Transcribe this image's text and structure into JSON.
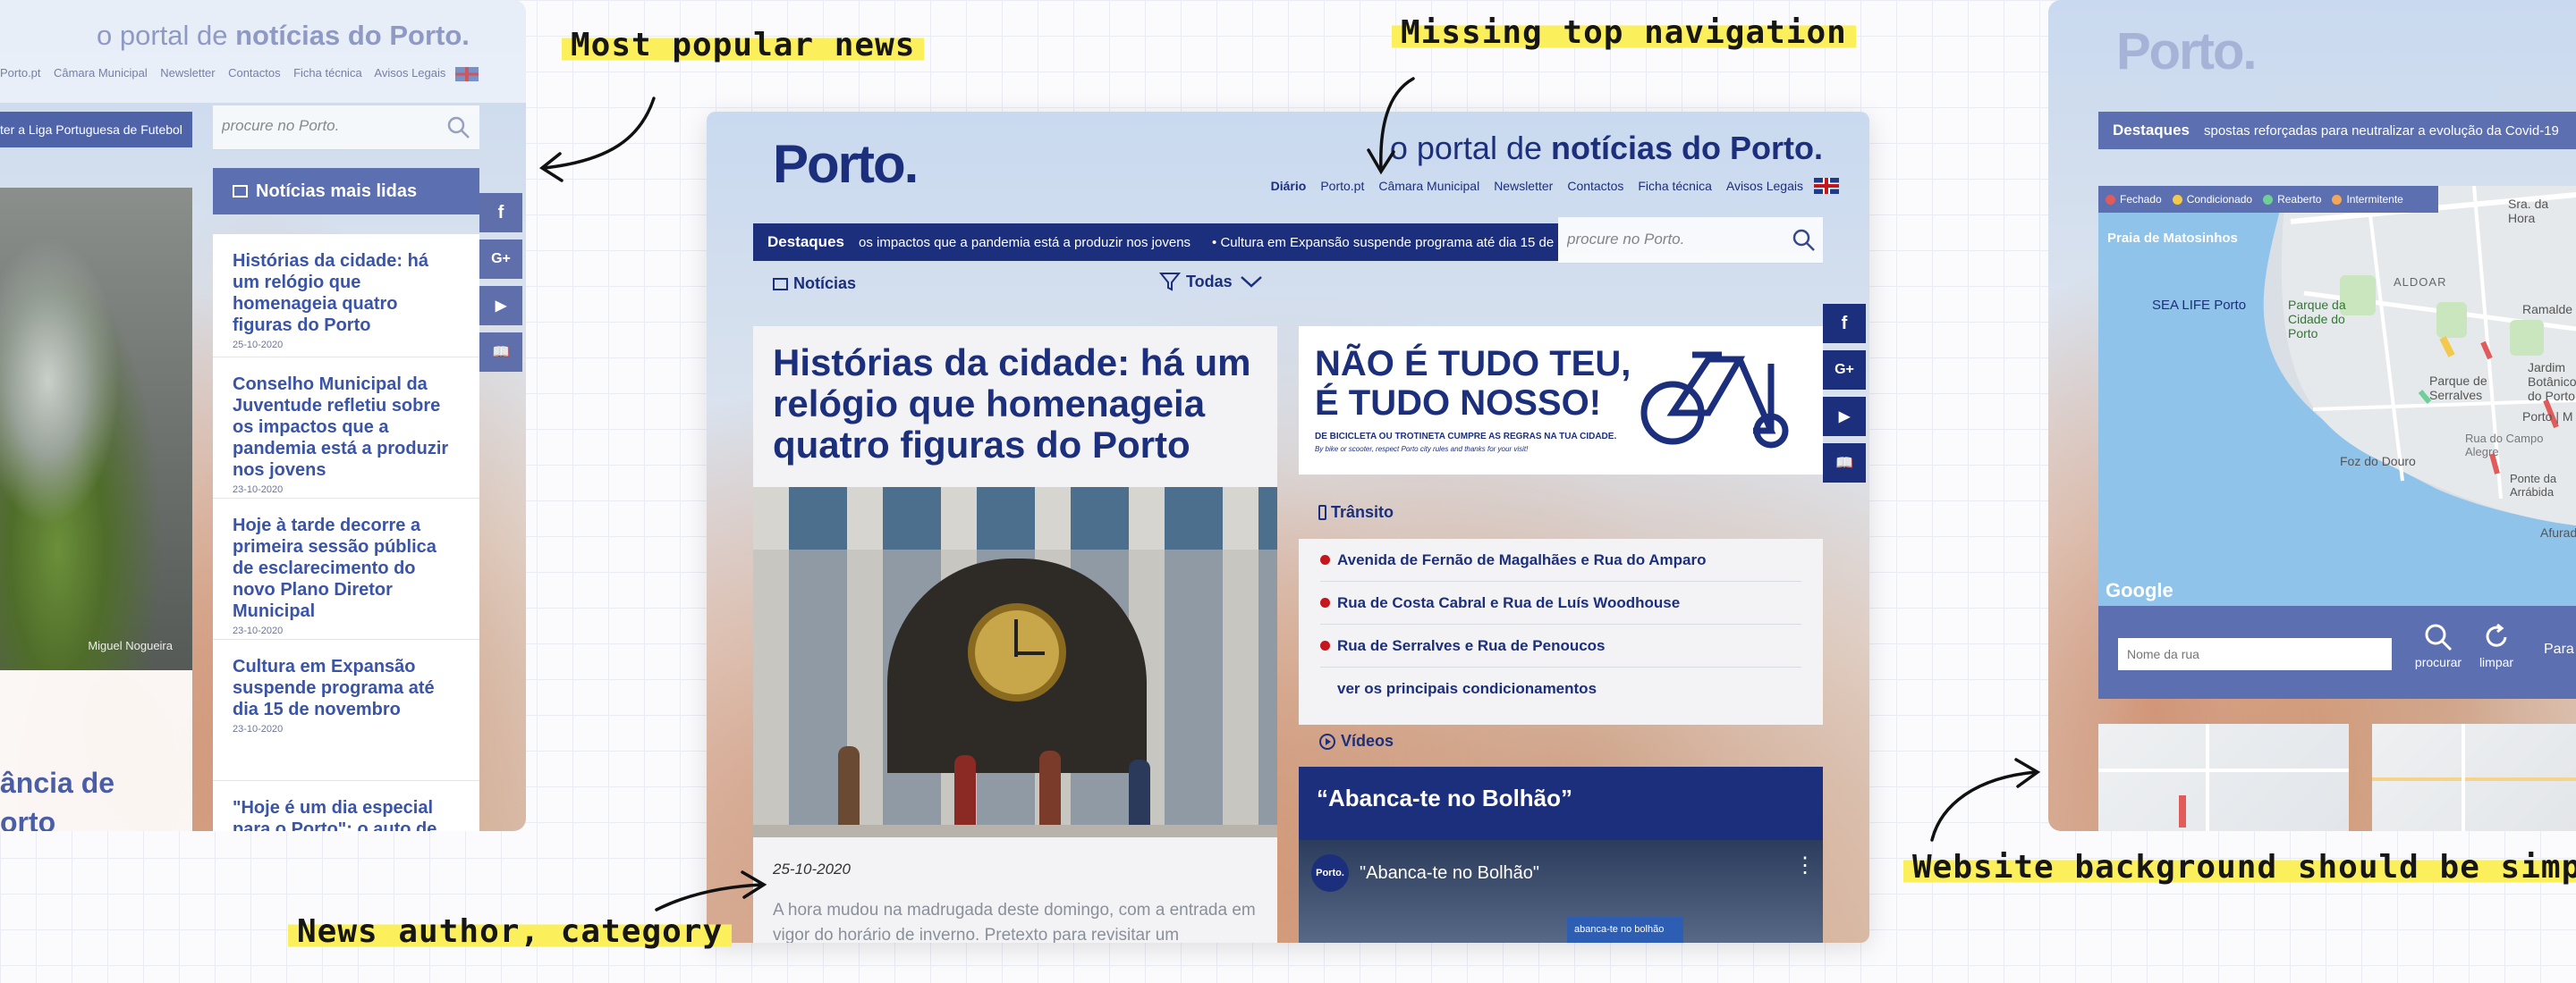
{
  "brand": {
    "logo": "Porto.",
    "tagline_prefix": "o portal de ",
    "tagline_bold": "notícias do Porto.",
    "navy": "#1c2f7c",
    "accent_red": "#c4161c",
    "annotation_yellow": "#fbef5c"
  },
  "annotations": {
    "popular": "Most popular news",
    "navigation": "Missing top navigation",
    "author": "News author, category",
    "background": "Website background should be simplified"
  },
  "nav": {
    "items": [
      "Diário",
      "Porto.pt",
      "Câmara Municipal",
      "Newsletter",
      "Contactos",
      "Ficha técnica",
      "Avisos Legais"
    ],
    "items_left_cut": [
      "Porto.pt",
      "Câmara Municipal",
      "Newsletter",
      "Contactos",
      "Ficha técnica",
      "Avisos Legais"
    ],
    "flag_icon": "uk-flag-icon"
  },
  "search": {
    "placeholder": "procure no Porto."
  },
  "destaques": {
    "label": "Destaques",
    "ticker_center_1": "os impactos que a pandemia está a produzir nos jovens",
    "ticker_center_2": "• Cultura em Expansão suspende programa até dia 15 de",
    "ticker_left": "ter a Liga Portuguesa de Futebol",
    "ticker_right": "spostas reforçadas para neutralizar a evolução da Covid-19"
  },
  "left": {
    "photo_credit": "Miguel Nogueira",
    "headline_cut_1": "ância de",
    "headline_cut_2": "orto",
    "mais_lidas_title": "Notícias mais lidas",
    "items": [
      {
        "title": "Histórias da cidade: há um relógio que homenageia quatro figuras do Porto",
        "date": "25-10-2020"
      },
      {
        "title": "Conselho Municipal da Juventude refletiu sobre os impactos que a pandemia está a produzir nos jovens",
        "date": "23-10-2020"
      },
      {
        "title": "Hoje à tarde decorre a primeira sessão pública de esclarecimento do novo Plano Diretor Municipal",
        "date": "23-10-2020"
      },
      {
        "title": "Cultura em Expansão suspende programa até dia 15 de novembro",
        "date": "23-10-2020"
      },
      {
        "title": "\"Hoje é um dia especial para o Porto\": o auto de",
        "date": ""
      }
    ],
    "social": [
      "f",
      "G+",
      "▶",
      "📖"
    ]
  },
  "center": {
    "noticias_label": "Notícias",
    "filter_label": "Todas",
    "article_title": "Histórias da cidade: há um relógio que homenageia quatro figuras do Porto",
    "article_date": "25-10-2020",
    "article_excerpt": "A hora mudou na madrugada deste domingo, com a entrada em vigor do horário de inverno. Pretexto para revisitar um",
    "ad_line1": "NÃO É TUDO TEU,",
    "ad_line2": "É TUDO NOSSO!",
    "ad_sub": "DE BICICLETA OU TROTINETA CUMPRE AS REGRAS NA TUA CIDADE.",
    "ad_sub_en": "By bike or scooter, respect Porto city rules and thanks for your visit!",
    "transito_label": "Trânsito",
    "transito_items": [
      "Avenida de Fernão de Magalhães e Rua do Amparo",
      "Rua de Costa Cabral e Rua de Luís Woodhouse",
      "Rua de Serralves e Rua de Penoucos"
    ],
    "transito_link": "ver os principais condicionamentos",
    "videos_label": "Vídeos",
    "video_title": "“Abanca-te no Bolhão”",
    "video_embed_title": "\"Abanca-te no Bolhão\"",
    "video_badge": "Porto.",
    "video_screen_text": "abanca-te no bolhão"
  },
  "right": {
    "legend": [
      {
        "label": "Fechado",
        "color": "#e25b5b"
      },
      {
        "label": "Condicionado",
        "color": "#f2c94c"
      },
      {
        "label": "Reaberto",
        "color": "#6fcf97"
      },
      {
        "label": "Intermitente",
        "color": "#f2a65a"
      }
    ],
    "map_labels": [
      "Praia de Matosinhos",
      "SEA LIFE Porto",
      "Parque da Cidade do Porto",
      "ALDOAR",
      "Ramalde",
      "Sra. da Hora",
      "Parque de Serralves",
      "Foz do Douro",
      "Porto | M",
      "Jardim Botânico do Porto",
      "Rua do Campo Alegre",
      "Afurada",
      "Ponte da Arrábida"
    ],
    "google": "Google",
    "street_placeholder": "Nome da rua",
    "procurar": "procurar",
    "limpar": "limpar",
    "para": "Para"
  }
}
